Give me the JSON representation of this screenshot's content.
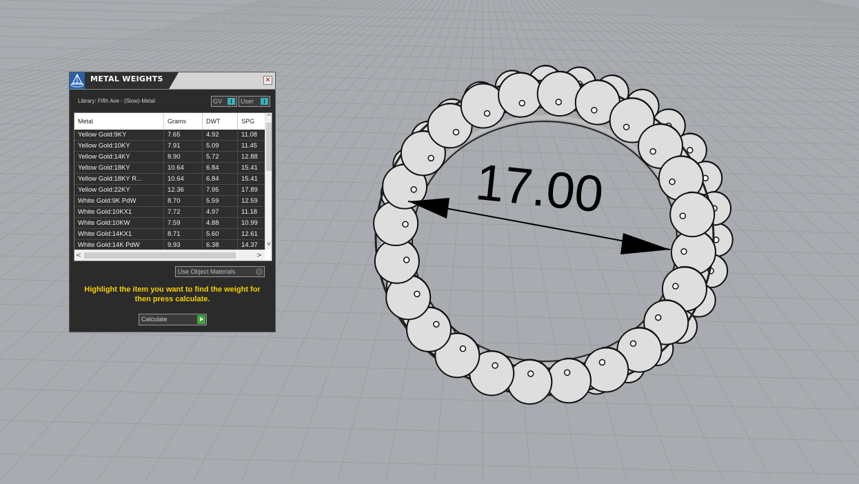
{
  "viewport": {
    "dimension_text": "17.00",
    "colors": {
      "background": "#a8acb0",
      "grid": "#9a9da1",
      "ring": "#dedede"
    }
  },
  "panel": {
    "title": "METAL WEIGHTS",
    "close_label": "✕",
    "library_label": "Library: Fifth Ave - (Slow)-Metal",
    "toggle_gv": "GV",
    "toggle_user": "User",
    "columns": [
      "Metal",
      "Grams",
      "DWT",
      "SPG"
    ],
    "rows": [
      [
        "Yellow Gold:9KY",
        "7.65",
        "4.92",
        "11.08"
      ],
      [
        "Yellow Gold:10KY",
        "7.91",
        "5.09",
        "11.45"
      ],
      [
        "Yellow Gold:14KY",
        "8.90",
        "5.72",
        "12.88"
      ],
      [
        "Yellow Gold:18KY",
        "10.64",
        "6.84",
        "15.41"
      ],
      [
        "Yellow Gold:18KY R...",
        "10.64",
        "6.84",
        "15.41"
      ],
      [
        "Yellow Gold:22KY",
        "12.36",
        "7.95",
        "17.89"
      ],
      [
        "White Gold:9K PdW",
        "8.70",
        "5.59",
        "12.59"
      ],
      [
        "White Gold:10KX1",
        "7.72",
        "4.97",
        "11.18"
      ],
      [
        "White Gold:10KW",
        "7.59",
        "4.88",
        "10.99"
      ],
      [
        "White Gold:14KX1",
        "8.71",
        "5.60",
        "12.61"
      ],
      [
        "White Gold:14K PdW",
        "9.93",
        "6.38",
        "14.37"
      ]
    ],
    "use_object_materials": "Use Object Materials",
    "instruction": "Highlight the item you want to find the weight for then press calculate.",
    "calculate_label": "Calculate",
    "accent_teal": "#39b3b8",
    "instruction_color": "#f5d000"
  }
}
